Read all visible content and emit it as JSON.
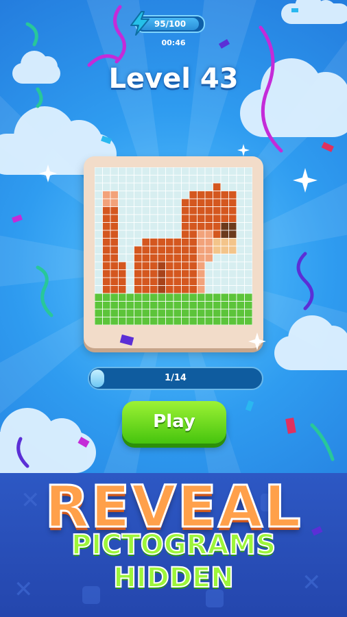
{
  "hud": {
    "energy_text": "95/100",
    "energy_fraction": 0.95,
    "timer": "00:46",
    "icon": "lightning-bolt-icon"
  },
  "level": {
    "title": "Level 43"
  },
  "puzzle": {
    "progress_text": "1/14",
    "progress_fraction": 0.071
  },
  "play_button": {
    "label": "Play"
  },
  "promo": {
    "line1": "REVEAL",
    "line2": "PICTOGRAMS",
    "line3": "HIDDEN"
  },
  "colors": {
    "sky": "#2f9cf0",
    "accent_green": "#46c40e",
    "title_orange": "#ffa04a",
    "fox_orange": "#d4571f"
  }
}
